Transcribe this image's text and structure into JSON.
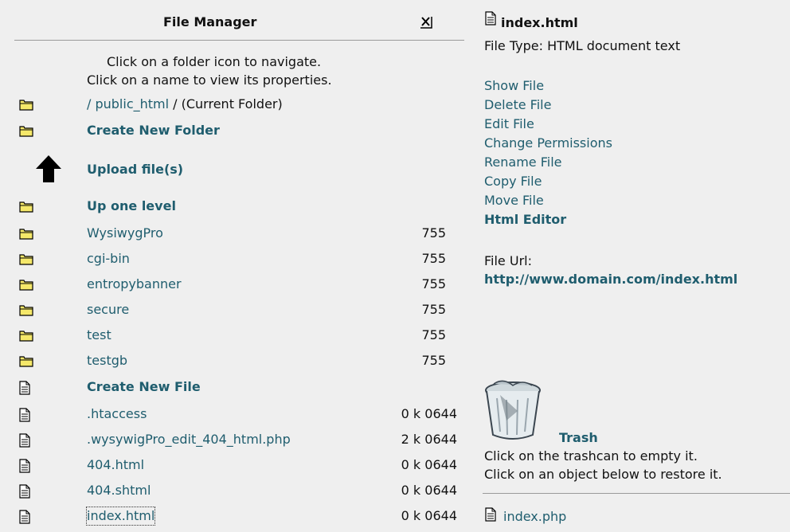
{
  "file_manager": {
    "title": "File Manager",
    "close_glyph": "x",
    "instructions": [
      "Click on a folder icon to navigate.",
      "Click on a name to view its properties."
    ],
    "path_link": "/ public_html",
    "path_suffix": " / (Current Folder)",
    "create_folder": "Create New Folder",
    "upload": "Upload file(s)",
    "up_level": "Up one level",
    "folders": [
      {
        "name": "WysiwygPro",
        "perm": "755"
      },
      {
        "name": "cgi-bin",
        "perm": "755"
      },
      {
        "name": "entropybanner",
        "perm": "755"
      },
      {
        "name": "secure",
        "perm": "755"
      },
      {
        "name": "test",
        "perm": "755"
      },
      {
        "name": "testgb",
        "perm": "755"
      }
    ],
    "create_file": "Create New File",
    "files": [
      {
        "name": ".htaccess",
        "info": "0 k 0644"
      },
      {
        "name": ".wysywigPro_edit_404_html.php",
        "info": "2 k 0644"
      },
      {
        "name": "404.html",
        "info": "0 k 0644"
      },
      {
        "name": "404.shtml",
        "info": "0 k 0644"
      },
      {
        "name": "index.html",
        "info": "0 k 0644"
      }
    ]
  },
  "properties": {
    "filename": "index.html",
    "file_type": "File Type: HTML document text",
    "actions": [
      "Show File",
      "Delete File",
      "Edit File",
      "Change Permissions",
      "Rename File",
      "Copy File",
      "Move File"
    ],
    "html_editor": "Html Editor",
    "url_label": "File Url:",
    "url": "http://www.domain.com/index.html"
  },
  "trash": {
    "label": "Trash",
    "line1": "Click on the trashcan to empty it.",
    "line2": "Click on an object below to restore it.",
    "items": [
      "index.php"
    ]
  }
}
